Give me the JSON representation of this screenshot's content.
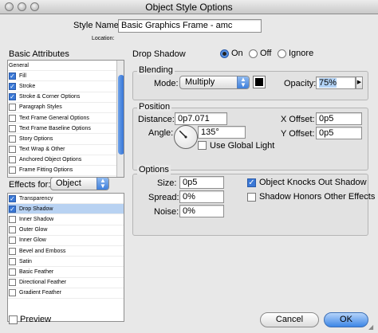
{
  "window": {
    "title": "Object Style Options"
  },
  "header": {
    "style_name_label": "Style Name:",
    "style_name_value": "Basic Graphics Frame - amc",
    "location_label": "Location:"
  },
  "sidebar": {
    "basic_attributes_title": "Basic Attributes",
    "basic_items": [
      {
        "label": "General",
        "checkbox": false,
        "checked": false
      },
      {
        "label": "Fill",
        "checkbox": true,
        "checked": true
      },
      {
        "label": "Stroke",
        "checkbox": true,
        "checked": true
      },
      {
        "label": "Stroke & Corner Options",
        "checkbox": true,
        "checked": true
      },
      {
        "label": "Paragraph Styles",
        "checkbox": true,
        "checked": false
      },
      {
        "label": "Text Frame General Options",
        "checkbox": true,
        "checked": false
      },
      {
        "label": "Text Frame Baseline Options",
        "checkbox": true,
        "checked": false
      },
      {
        "label": "Story Options",
        "checkbox": true,
        "checked": false
      },
      {
        "label": "Text Wrap & Other",
        "checkbox": true,
        "checked": false
      },
      {
        "label": "Anchored Object Options",
        "checkbox": true,
        "checked": false
      },
      {
        "label": "Frame Fitting Options",
        "checkbox": true,
        "checked": false
      }
    ],
    "effects_for_label": "Effects for:",
    "effects_for_value": "Object",
    "effect_items": [
      {
        "label": "Transparency",
        "checked": true,
        "selected": false
      },
      {
        "label": "Drop Shadow",
        "checked": true,
        "selected": true
      },
      {
        "label": "Inner Shadow",
        "checked": false,
        "selected": false
      },
      {
        "label": "Outer Glow",
        "checked": false,
        "selected": false
      },
      {
        "label": "Inner Glow",
        "checked": false,
        "selected": false
      },
      {
        "label": "Bevel and Emboss",
        "checked": false,
        "selected": false
      },
      {
        "label": "Satin",
        "checked": false,
        "selected": false
      },
      {
        "label": "Basic Feather",
        "checked": false,
        "selected": false
      },
      {
        "label": "Directional Feather",
        "checked": false,
        "selected": false
      },
      {
        "label": "Gradient Feather",
        "checked": false,
        "selected": false
      }
    ]
  },
  "main": {
    "section_title": "Drop Shadow",
    "radios": {
      "on": "On",
      "off": "Off",
      "ignore": "Ignore",
      "selected": "on"
    },
    "blending": {
      "title": "Blending",
      "mode_label": "Mode:",
      "mode_value": "Multiply",
      "opacity_label": "Opacity:",
      "opacity_value": "75%",
      "swatch_color": "#000000"
    },
    "position": {
      "title": "Position",
      "distance_label": "Distance:",
      "distance_value": "0p7.071",
      "angle_label": "Angle:",
      "angle_value": "135°",
      "angle_degrees": 135,
      "global_light_label": "Use Global Light",
      "global_light_checked": false,
      "x_offset_label": "X Offset:",
      "x_offset_value": "0p5",
      "y_offset_label": "Y Offset:",
      "y_offset_value": "0p5"
    },
    "options": {
      "title": "Options",
      "size_label": "Size:",
      "size_value": "0p5",
      "spread_label": "Spread:",
      "spread_value": "0%",
      "noise_label": "Noise:",
      "noise_value": "0%",
      "knocks_out_label": "Object Knocks Out Shadow",
      "knocks_out_checked": true,
      "honors_effects_label": "Shadow Honors Other Effects",
      "honors_effects_checked": false
    }
  },
  "footer": {
    "preview_label": "Preview",
    "preview_checked": false,
    "cancel_label": "Cancel",
    "ok_label": "OK"
  },
  "colors": {
    "accent": "#3a78d6",
    "selection": "#b8d2f2"
  }
}
